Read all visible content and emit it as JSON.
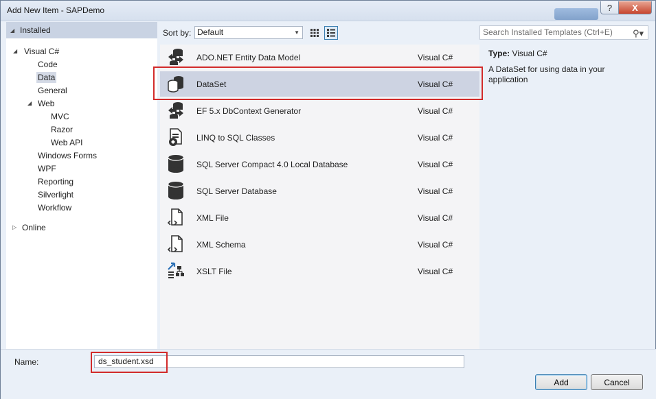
{
  "window": {
    "title": "Add New Item - SAPDemo",
    "help_glyph": "?",
    "close_glyph": "X"
  },
  "left_pane": {
    "header": "Installed",
    "tree": [
      {
        "label": "Visual C#",
        "expander": "◢"
      },
      {
        "label": "Code"
      },
      {
        "label": "Data"
      },
      {
        "label": "General"
      },
      {
        "label": "Web",
        "expander": "◢"
      },
      {
        "label": "MVC"
      },
      {
        "label": "Razor"
      },
      {
        "label": "Web API"
      },
      {
        "label": "Windows Forms"
      },
      {
        "label": "WPF"
      },
      {
        "label": "Reporting"
      },
      {
        "label": "Silverlight"
      },
      {
        "label": "Workflow"
      },
      {
        "label": "Online",
        "expander": "▷"
      }
    ]
  },
  "toolbar": {
    "sort_label": "Sort by:",
    "sort_value": "Default",
    "search_placeholder": "Search Installed Templates (Ctrl+E)"
  },
  "templates": [
    {
      "name": "ADO.NET Entity Data Model",
      "lang": "Visual C#",
      "icon": "entity-model-icon"
    },
    {
      "name": "DataSet",
      "lang": "Visual C#",
      "icon": "dataset-icon"
    },
    {
      "name": "EF 5.x DbContext Generator",
      "lang": "Visual C#",
      "icon": "dbcontext-generator-icon"
    },
    {
      "name": "LINQ to SQL Classes",
      "lang": "Visual C#",
      "icon": "linq-to-sql-icon"
    },
    {
      "name": "SQL Server Compact 4.0 Local Database",
      "lang": "Visual C#",
      "icon": "database-icon"
    },
    {
      "name": "SQL Server Database",
      "lang": "Visual C#",
      "icon": "database-icon"
    },
    {
      "name": "XML File",
      "lang": "Visual C#",
      "icon": "xml-file-icon"
    },
    {
      "name": "XML Schema",
      "lang": "Visual C#",
      "icon": "xml-schema-icon"
    },
    {
      "name": "XSLT File",
      "lang": "Visual C#",
      "icon": "xslt-file-icon"
    }
  ],
  "details": {
    "type_label": "Type:",
    "type_value": "Visual C#",
    "description": "A DataSet for using data in your application"
  },
  "footer": {
    "name_label": "Name:",
    "name_value": "ds_student.xsd",
    "add_label": "Add",
    "cancel_label": "Cancel"
  },
  "colors": {
    "highlight": "#d22a2a",
    "selected_row": "#cdd3e2"
  }
}
